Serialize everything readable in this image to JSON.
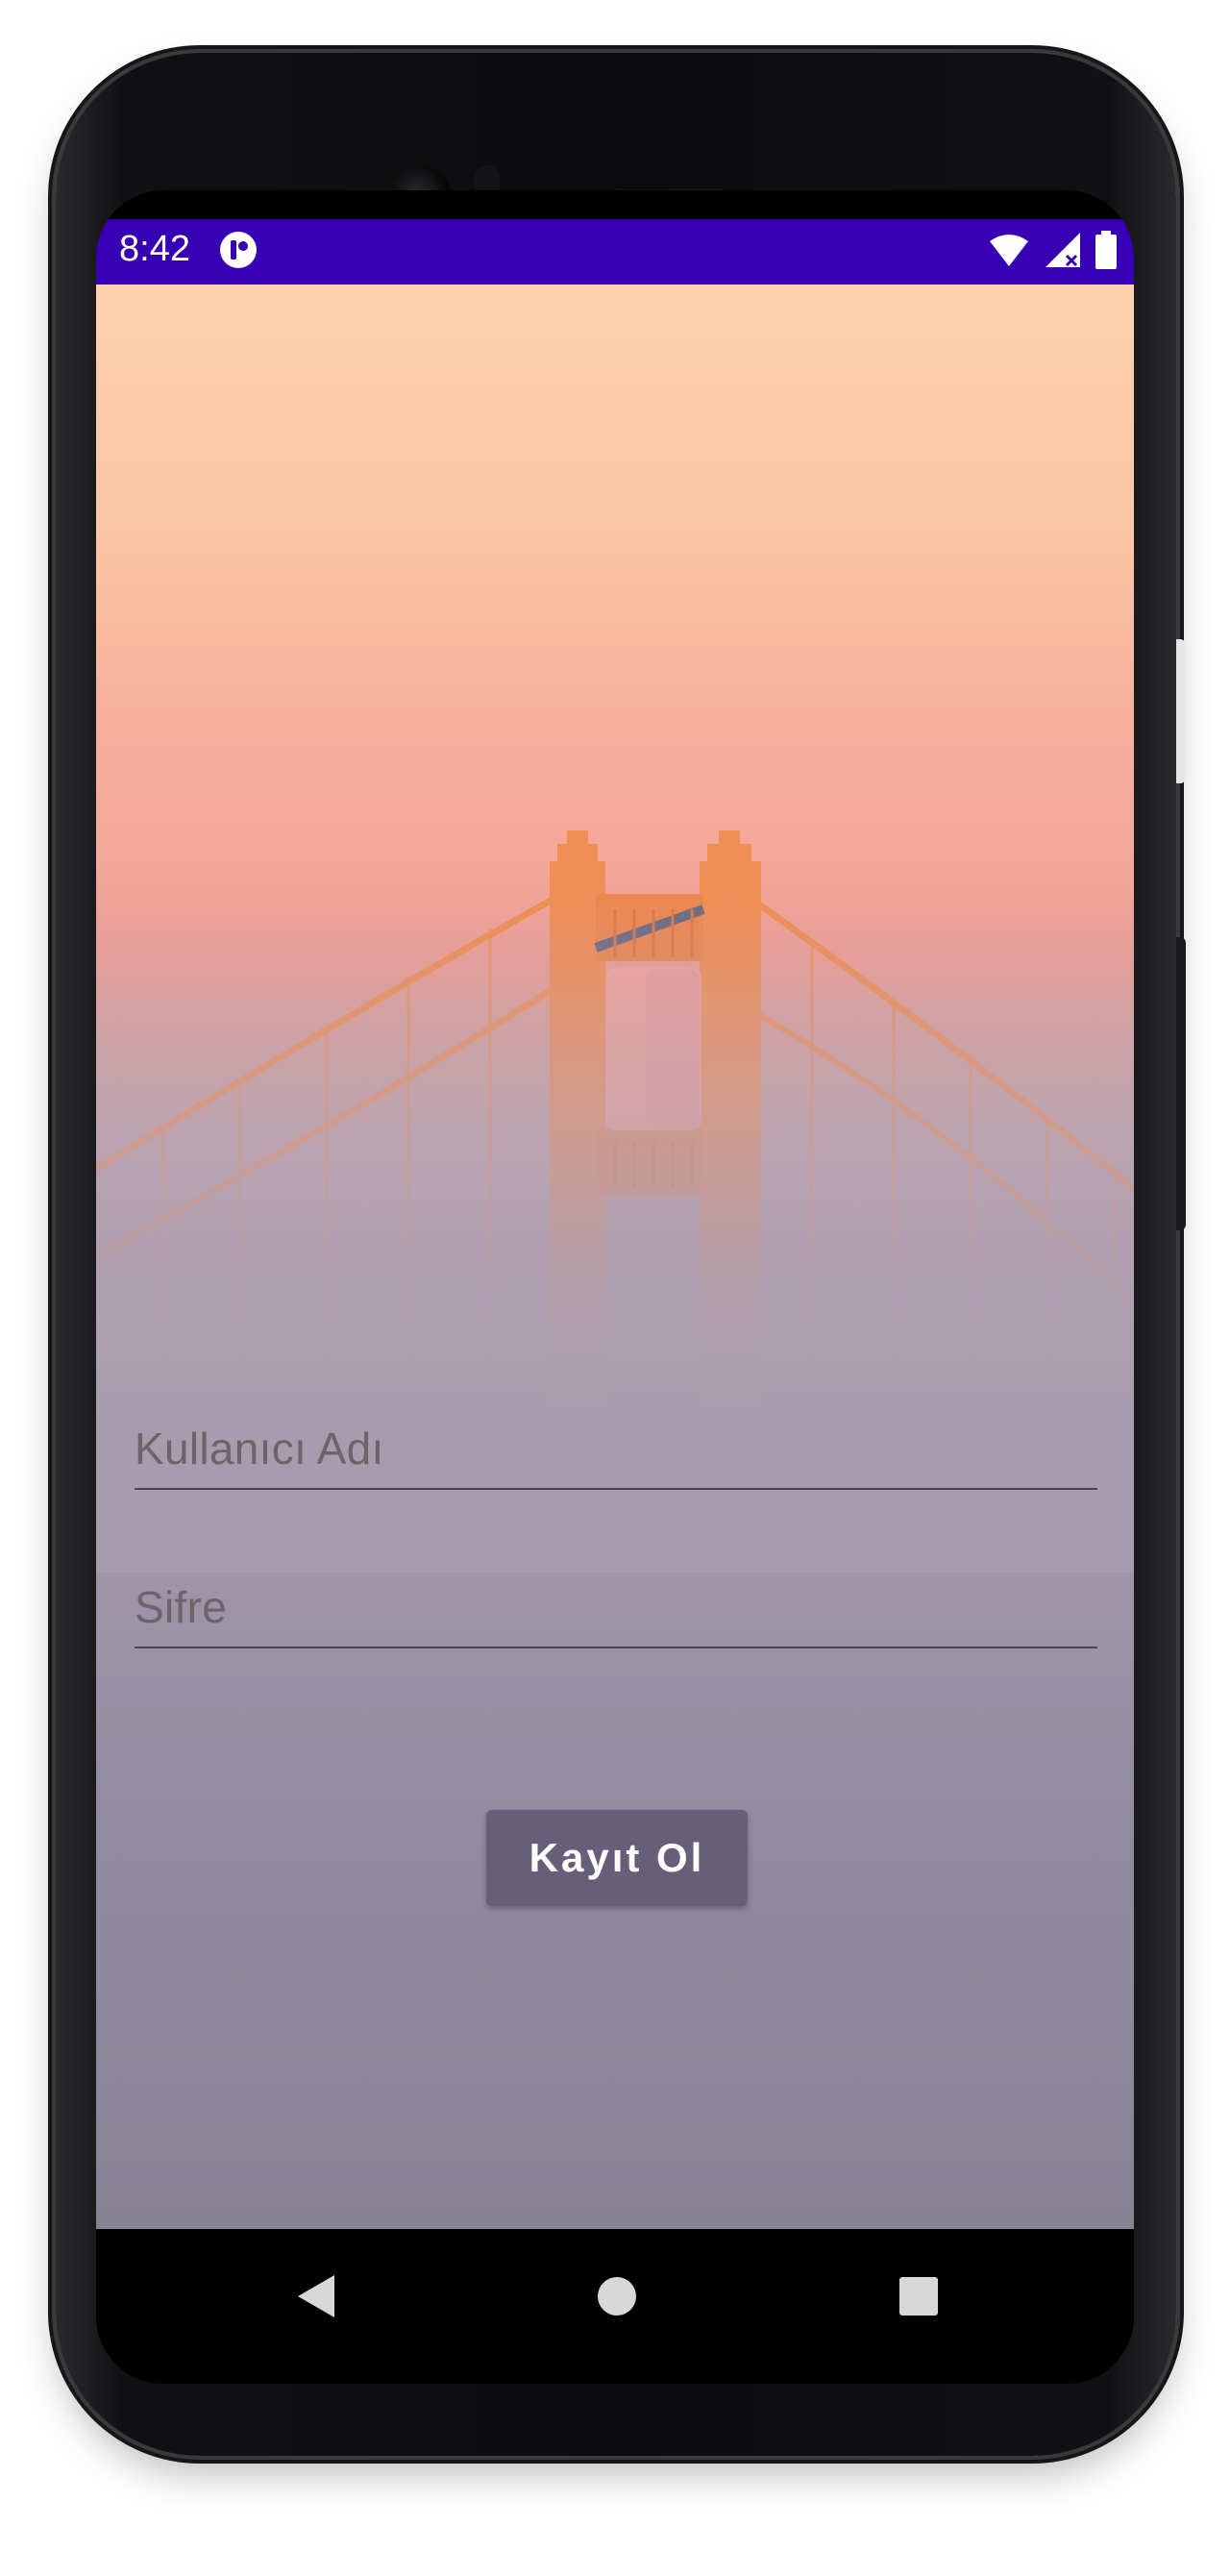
{
  "status_bar": {
    "time": "8:42",
    "background_color": "#3700b3",
    "icons": [
      "app-notification-icon",
      "wifi-icon",
      "cellular-signal-icon",
      "battery-icon"
    ]
  },
  "form": {
    "username_placeholder": "Kullanıcı Adı",
    "password_placeholder": "Sifre",
    "register_button_label": "Kayıt Ol"
  },
  "nav_bar": {
    "icons": [
      "back-icon",
      "home-icon",
      "recents-icon"
    ]
  },
  "colors": {
    "button": "#675e79",
    "bridge": "#ef8e55"
  }
}
